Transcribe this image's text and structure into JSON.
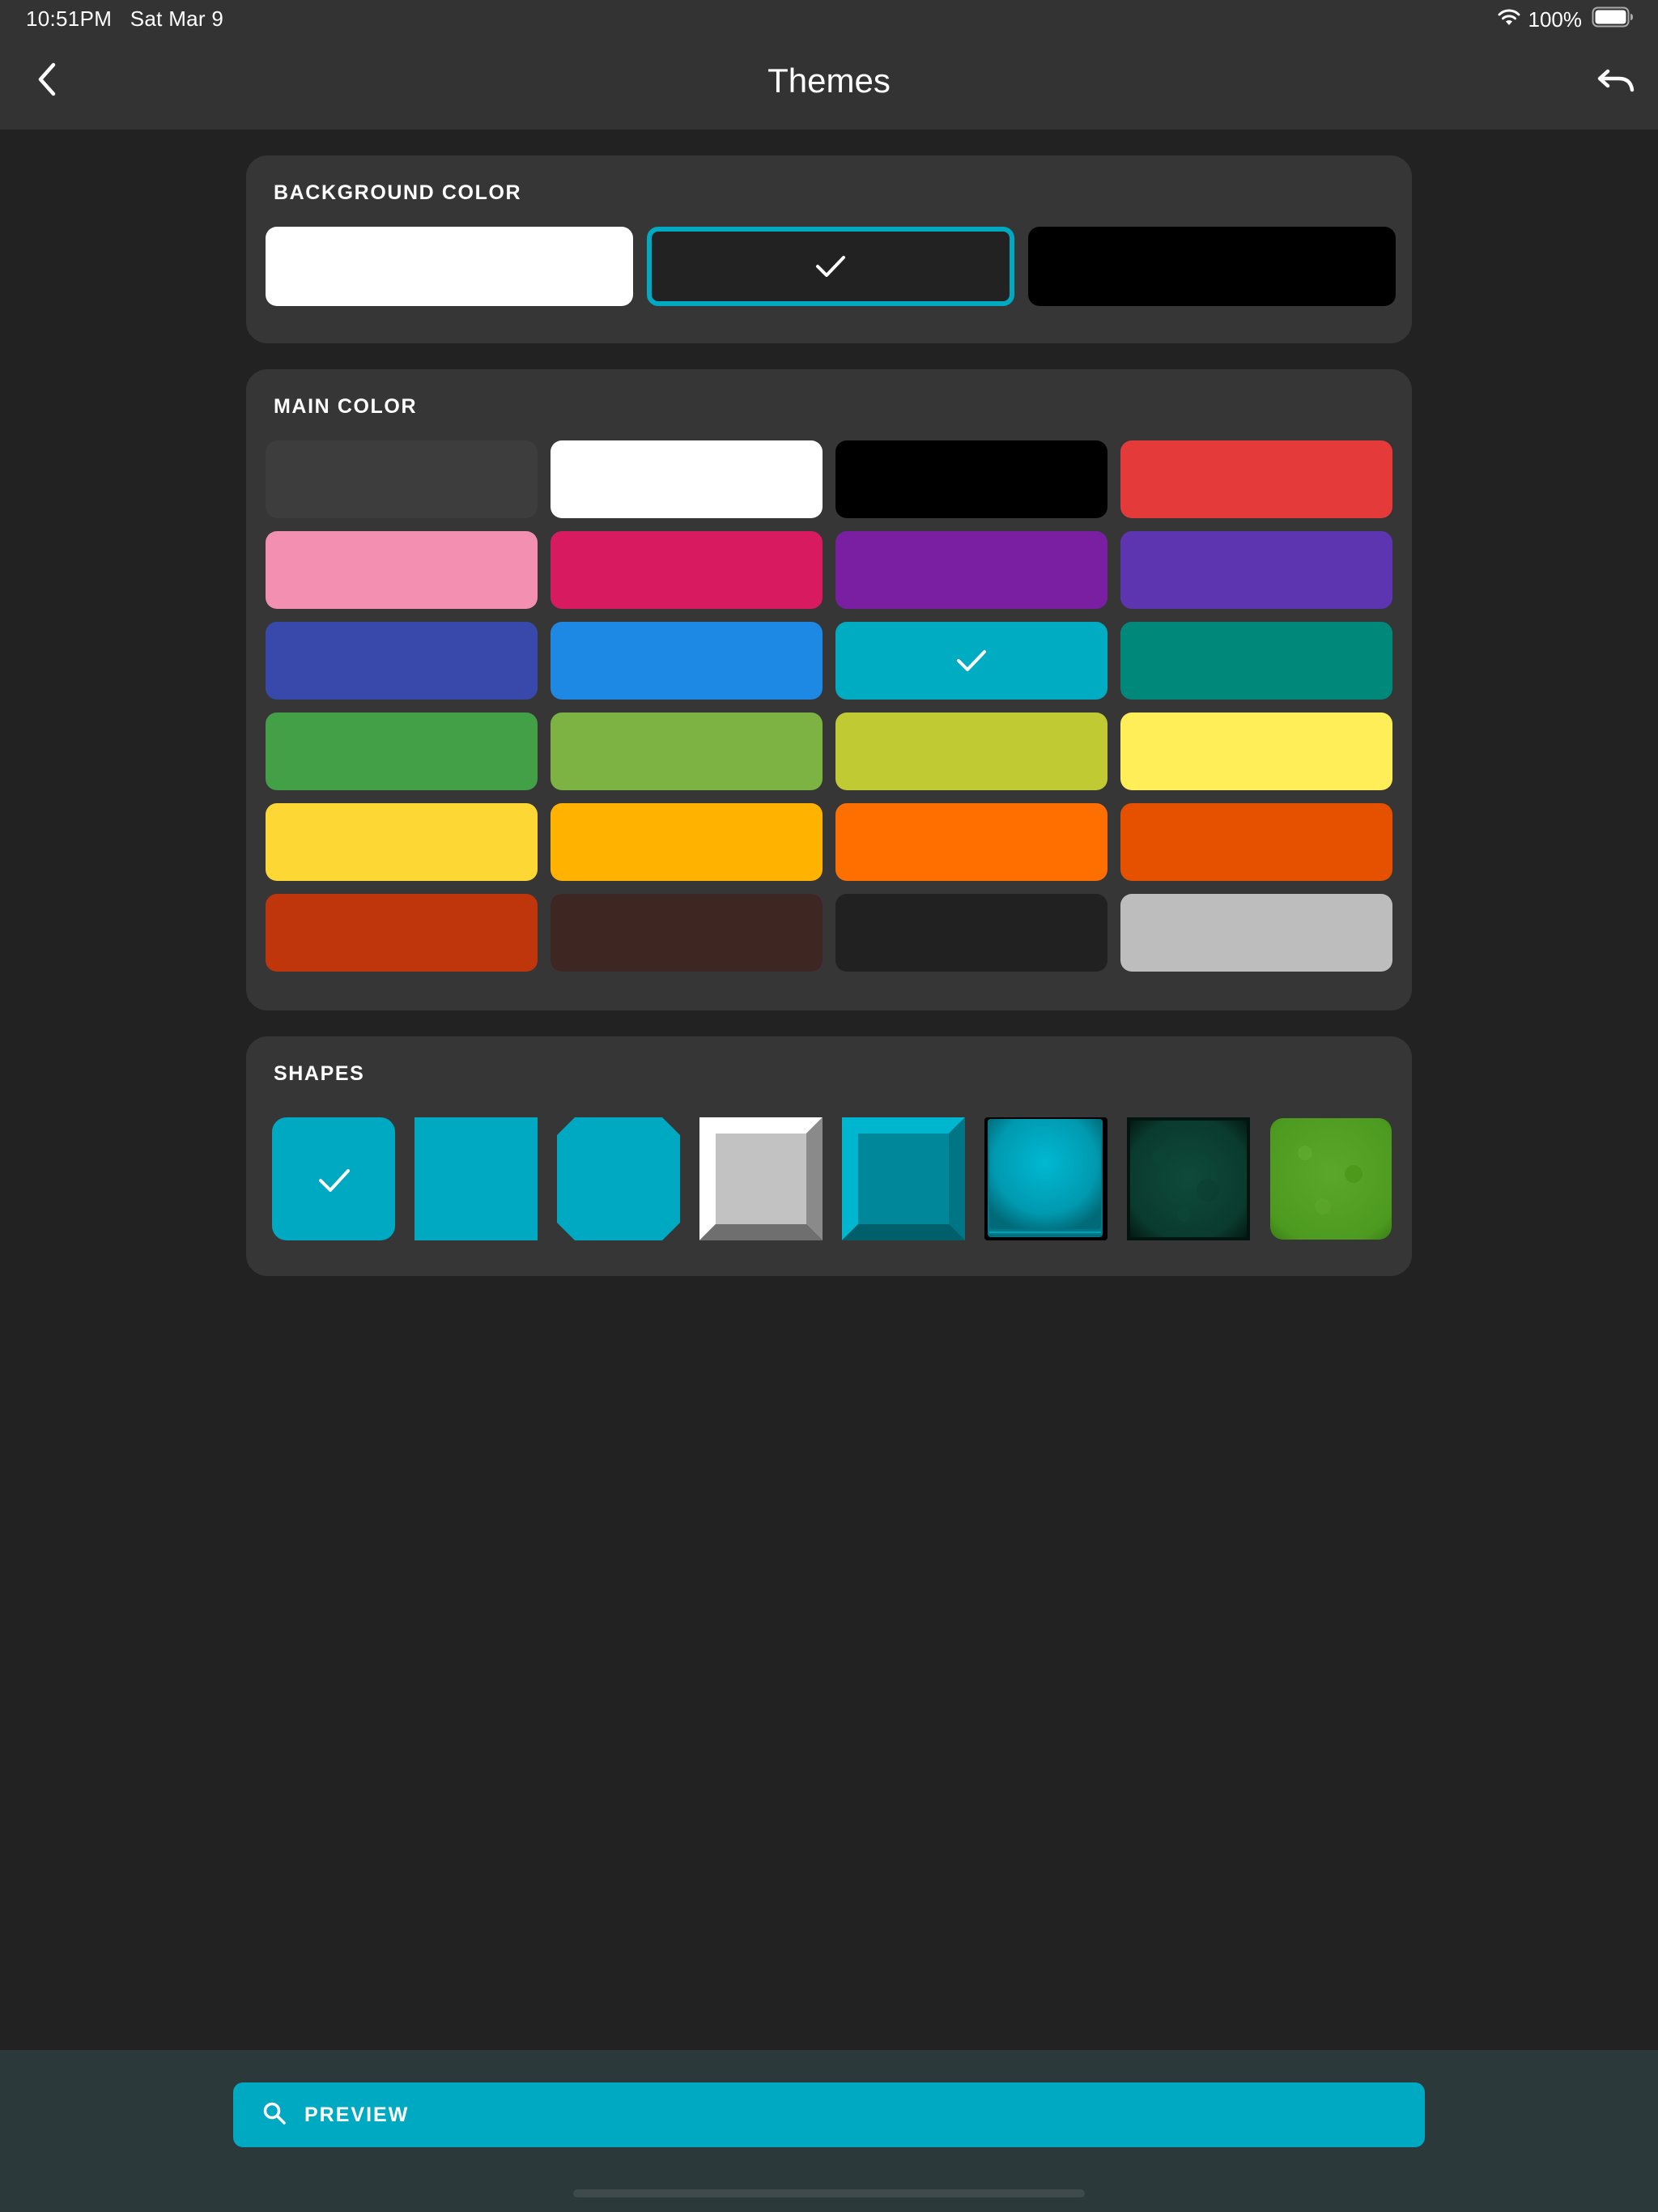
{
  "status_bar": {
    "time": "10:51PM",
    "date": "Sat Mar 9",
    "battery": "100%"
  },
  "nav": {
    "title": "Themes",
    "back_icon": "chevron-left-icon",
    "undo_icon": "undo-icon"
  },
  "background_color": {
    "title": "BACKGROUND COLOR",
    "swatches": [
      {
        "name": "white",
        "color": "#ffffff",
        "selected": false
      },
      {
        "name": "dark",
        "color": "#222222",
        "selected": true
      },
      {
        "name": "black",
        "color": "#000000",
        "selected": false
      }
    ],
    "selected_border_color": "#00a9c2"
  },
  "main_color": {
    "title": "MAIN COLOR",
    "swatches": [
      {
        "name": "dark-gray",
        "color": "#3d3d3d",
        "selected": false
      },
      {
        "name": "white",
        "color": "#ffffff",
        "selected": false
      },
      {
        "name": "black",
        "color": "#000000",
        "selected": false
      },
      {
        "name": "red",
        "color": "#e43a3a",
        "selected": false
      },
      {
        "name": "pink",
        "color": "#f38fb1",
        "selected": false
      },
      {
        "name": "magenta",
        "color": "#d81b60",
        "selected": false
      },
      {
        "name": "purple",
        "color": "#7b1fa2",
        "selected": false
      },
      {
        "name": "deep-purple",
        "color": "#5e35b1",
        "selected": false
      },
      {
        "name": "indigo",
        "color": "#3949ab",
        "selected": false
      },
      {
        "name": "blue",
        "color": "#1e88e5",
        "selected": false
      },
      {
        "name": "cyan",
        "color": "#00acc1",
        "selected": true
      },
      {
        "name": "teal",
        "color": "#00897b",
        "selected": false
      },
      {
        "name": "green",
        "color": "#43a047",
        "selected": false
      },
      {
        "name": "light-green",
        "color": "#7cb342",
        "selected": false
      },
      {
        "name": "lime",
        "color": "#c0ca33",
        "selected": false
      },
      {
        "name": "yellow",
        "color": "#ffee58",
        "selected": false
      },
      {
        "name": "amber-yellow",
        "color": "#fdd835",
        "selected": false
      },
      {
        "name": "amber",
        "color": "#ffb300",
        "selected": false
      },
      {
        "name": "orange",
        "color": "#ff6f00",
        "selected": false
      },
      {
        "name": "deep-orange",
        "color": "#e65100",
        "selected": false
      },
      {
        "name": "rust",
        "color": "#bf360c",
        "selected": false
      },
      {
        "name": "brown",
        "color": "#3e2723",
        "selected": false
      },
      {
        "name": "near-black",
        "color": "#212121",
        "selected": false
      },
      {
        "name": "light-gray",
        "color": "#bdbdbd",
        "selected": false
      }
    ]
  },
  "shapes": {
    "title": "SHAPES",
    "items": [
      {
        "name": "rounded-square",
        "selected": true
      },
      {
        "name": "square",
        "selected": false
      },
      {
        "name": "octagon",
        "selected": false
      },
      {
        "name": "beveled-gray",
        "selected": false
      },
      {
        "name": "beveled-cyan",
        "selected": false
      },
      {
        "name": "glow-stack",
        "selected": false
      },
      {
        "name": "dark-green-texture",
        "selected": false
      },
      {
        "name": "grass-texture",
        "selected": false
      }
    ]
  },
  "accent_color": "#00a9c2",
  "preview_button": {
    "label": "PREVIEW",
    "icon": "search-icon"
  }
}
